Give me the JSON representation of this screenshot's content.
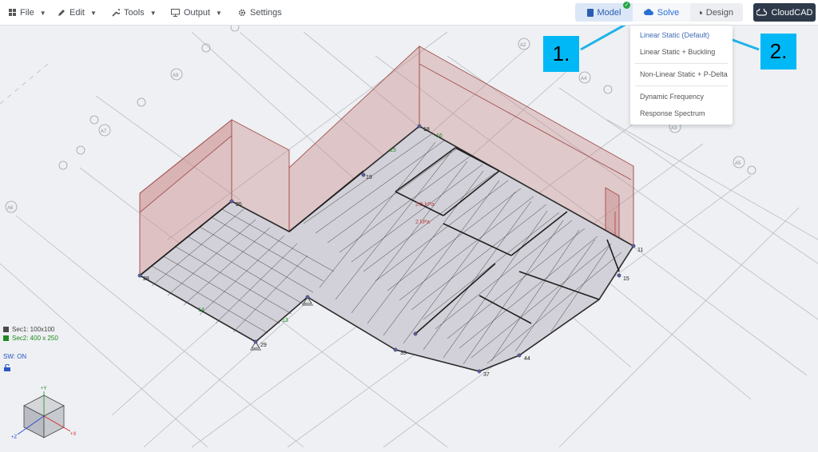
{
  "toolbar": {
    "file_label": "File",
    "edit_label": "Edit",
    "tools_label": "Tools",
    "output_label": "Output",
    "settings_label": "Settings"
  },
  "mode_tabs": {
    "model": "Model",
    "solve": "Solve",
    "design": "Design"
  },
  "cloudcad_label": "CloudCAD",
  "solve_menu": {
    "items": [
      "Linear Static (Default)",
      "Linear Static + Buckling",
      "Non-Linear Static + P-Delta",
      "Dynamic Frequency",
      "Response Spectrum"
    ]
  },
  "callouts": {
    "first": "1.",
    "second": "2."
  },
  "legend": {
    "sec1": "Sec1: 100x100",
    "sec2": "Sec2: 400 x 250",
    "sec1_color": "#4a4a4a",
    "sec2_color": "#1e8a1e"
  },
  "sw_status": "SW: ON",
  "grid_labels": [
    "A6",
    "A7",
    "A8",
    "A9",
    "A10",
    "A11",
    "A12",
    "A13",
    "A14",
    "A2",
    "A3",
    "A4",
    "A5",
    "A16",
    "A18",
    "A19",
    "A20"
  ],
  "node_labels": [
    "18",
    "16",
    "19",
    "11",
    "15",
    "25",
    "28",
    "29",
    "33",
    "37",
    "44"
  ],
  "member_labels": [
    "15",
    "14",
    "13"
  ],
  "load_labels": [
    "2.5 kPa",
    "2 kPa"
  ],
  "axis_labels": {
    "x": "+X",
    "y": "+Y",
    "z": "+Z"
  },
  "colors": {
    "accent": "#2a6fd6",
    "slab_fill": "#d2d0d8",
    "load_fill": "#c98a8a",
    "load_stroke": "#a55050",
    "callout_bg": "#00b8f5",
    "cloud_btn": "#2e3a4a"
  }
}
